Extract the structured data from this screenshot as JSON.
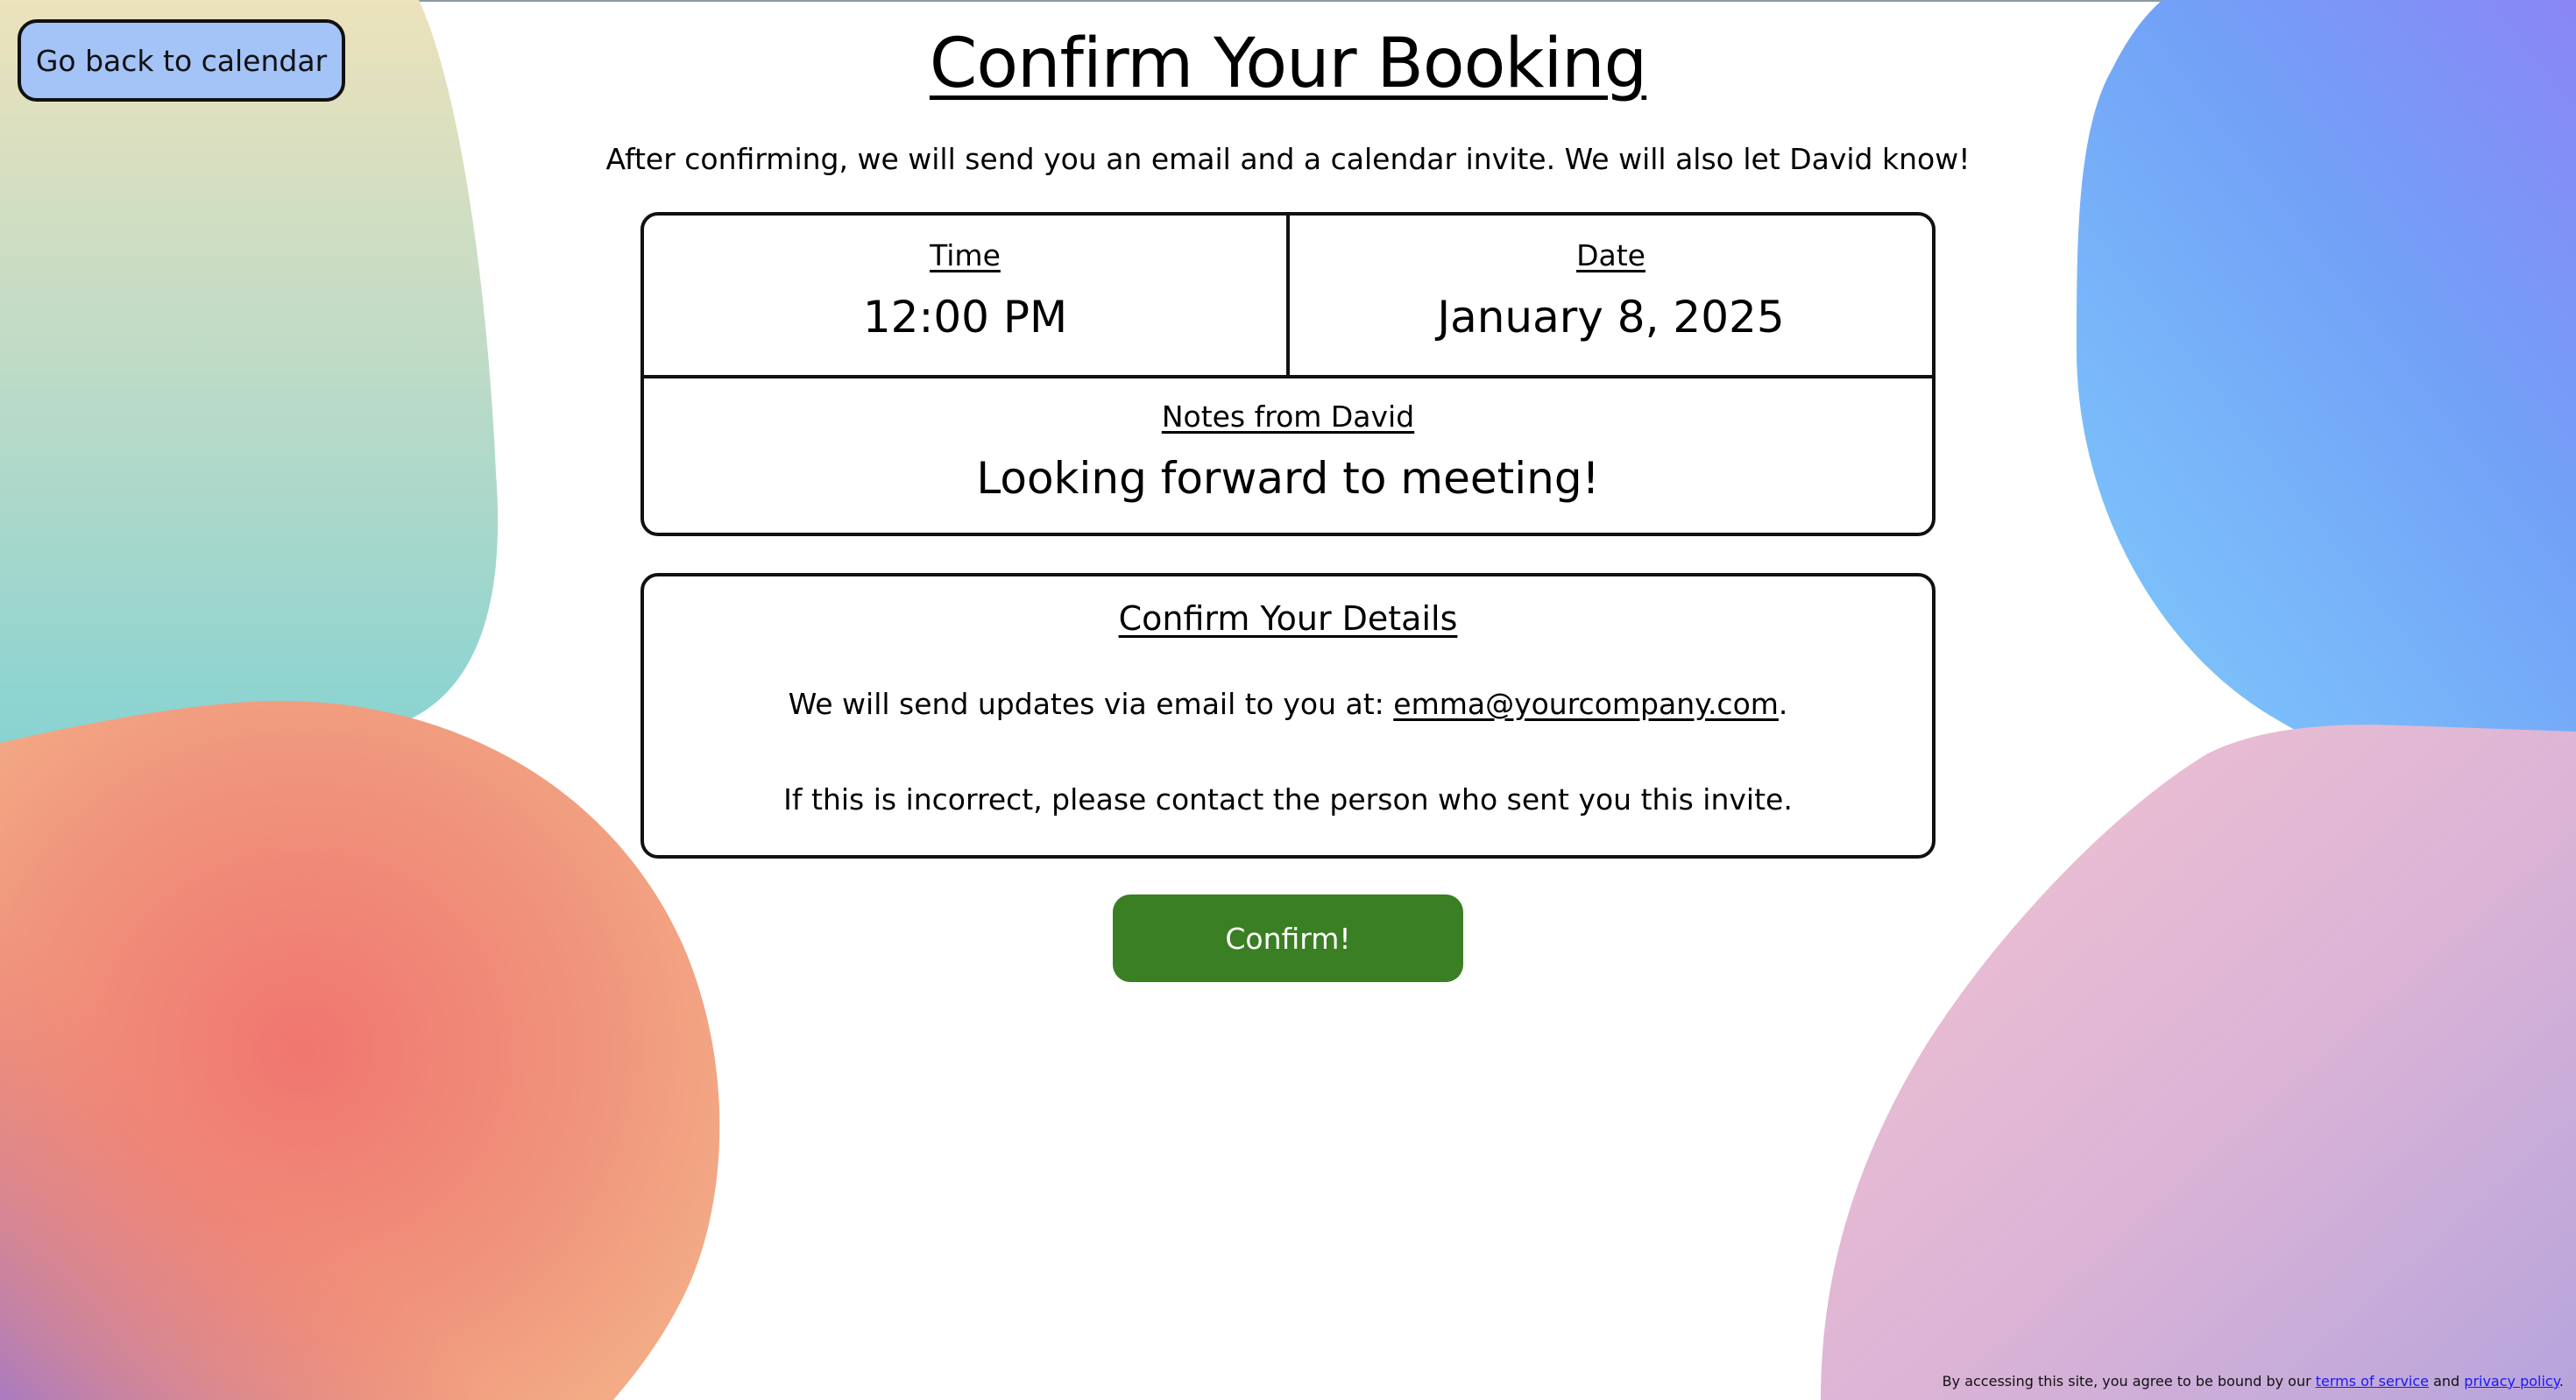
{
  "nav": {
    "back_label": "Go back to calendar"
  },
  "page": {
    "title": "Confirm Your Booking",
    "intro": "After confirming, we will send you an email and a calendar invite. We will also let David know!"
  },
  "booking": {
    "time_label": "Time",
    "time_value": "12:00 PM",
    "date_label": "Date",
    "date_value": "January 8, 2025",
    "notes_label": "Notes from David",
    "notes_value": "Looking forward to meeting!"
  },
  "details": {
    "title": "Confirm Your Details",
    "email_prefix": "We will send updates via email to you at: ",
    "email": "emma@yourcompany.com",
    "email_suffix": ".",
    "incorrect_notice": "If this is incorrect, please contact the person who sent you this invite."
  },
  "actions": {
    "confirm_label": "Confirm!"
  },
  "footer": {
    "prefix": "By accessing this site, you agree to be bound by our ",
    "terms_label": "terms of service",
    "and": " and ",
    "privacy_label": "privacy policy",
    "suffix": "."
  },
  "colors": {
    "back_button_bg": "#a4c3f7",
    "confirm_button_bg": "#3a7f23",
    "link_color": "#1a1aee"
  }
}
